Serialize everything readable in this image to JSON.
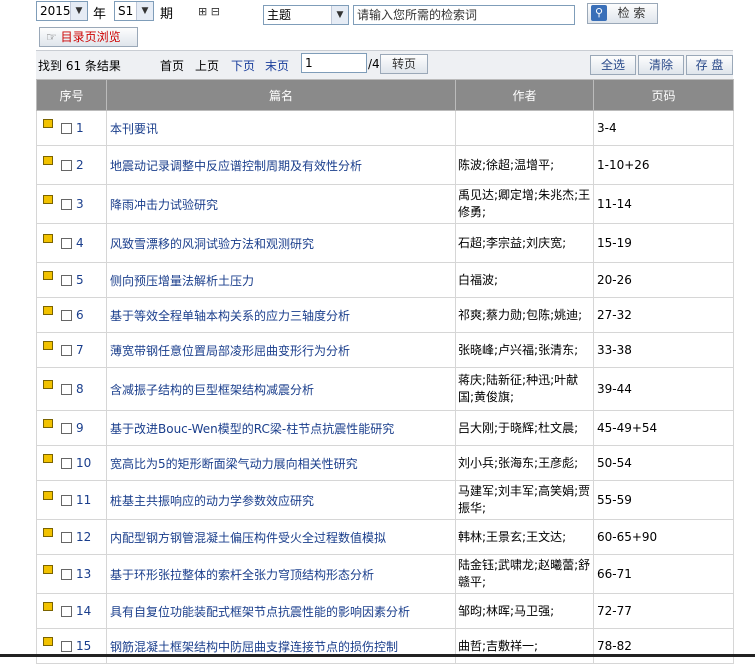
{
  "filter": {
    "year_value": "2015",
    "year_suffix": "年",
    "issue_value": "S1",
    "issue_suffix": "期",
    "expand_toggle": "⊞ ⊟",
    "field_value": "主题",
    "search_placeholder": "请输入您所需的检索词",
    "search_label": "检 索",
    "catalog_label": "目录页浏览"
  },
  "pager": {
    "result_count": "找到 61 条结果",
    "first": "首页",
    "prev": "上页",
    "next": "下页",
    "last": "末页",
    "page_value": "1",
    "page_total": "/4",
    "go": "转页",
    "select_all": "全选",
    "clear": "清除",
    "save": "存 盘"
  },
  "table": {
    "headers": [
      "序号",
      "篇名",
      "作者",
      "页码"
    ],
    "rows": [
      {
        "num": "1",
        "title": "本刊要讯",
        "author": "",
        "pages": "3-4"
      },
      {
        "num": "2",
        "title": "地震动记录调整中反应谱控制周期及有效性分析",
        "author": "陈波;徐超;温增平;",
        "pages": "1-10+26"
      },
      {
        "num": "3",
        "title": "降雨冲击力试验研究",
        "author": "禹见达;卿定增;朱兆杰;王修勇;",
        "pages": "11-14"
      },
      {
        "num": "4",
        "title": "风致雪漂移的风洞试验方法和观测研究",
        "author": "石超;李宗益;刘庆宽;",
        "pages": "15-19"
      },
      {
        "num": "5",
        "title": "侧向预压增量法解析土压力",
        "author": "白福波;",
        "pages": "20-26"
      },
      {
        "num": "6",
        "title": "基于等效全程单轴本构关系的应力三轴度分析",
        "author": "祁爽;蔡力勋;包陈;姚迪;",
        "pages": "27-32"
      },
      {
        "num": "7",
        "title": "薄宽带钢任意位置局部凌形屈曲变形行为分析",
        "author": "张晓峰;卢兴福;张清东;",
        "pages": "33-38"
      },
      {
        "num": "8",
        "title": "含减振子结构的巨型框架结构减震分析",
        "author": "蒋庆;陆新征;种迅;叶献国;黄俊旗;",
        "pages": "39-44"
      },
      {
        "num": "9",
        "title": "基于改进Bouc-Wen模型的RC梁-柱节点抗震性能研究",
        "author": "吕大刚;于晓辉;杜文晨;",
        "pages": "45-49+54"
      },
      {
        "num": "10",
        "title": "宽高比为5的矩形断面梁气动力展向相关性研究",
        "author": "刘小兵;张海东;王彦彪;",
        "pages": "50-54"
      },
      {
        "num": "11",
        "title": "桩基主共振响应的动力学参数效应研究",
        "author": "马建军;刘丰军;高笑娟;贾振华;",
        "pages": "55-59"
      },
      {
        "num": "12",
        "title": "内配型钢方钢管混凝土偏压构件受火全过程数值模拟",
        "author": "韩林;王景玄;王文达;",
        "pages": "60-65+90"
      },
      {
        "num": "13",
        "title": "基于环形张拉整体的索杆全张力穹顶结构形态分析",
        "author": "陆金钰;武啸龙;赵曦蕾;舒赣平;",
        "pages": "66-71"
      },
      {
        "num": "14",
        "title": "具有自复位功能装配式框架节点抗震性能的影响因素分析",
        "author": "邹昀;林晖;马卫强;",
        "pages": "72-77"
      },
      {
        "num": "15",
        "title": "钢筋混凝土框架结构中防屈曲支撑连接节点的损伤控制",
        "author": "曲哲;吉敷祥一;",
        "pages": "78-82"
      }
    ]
  }
}
